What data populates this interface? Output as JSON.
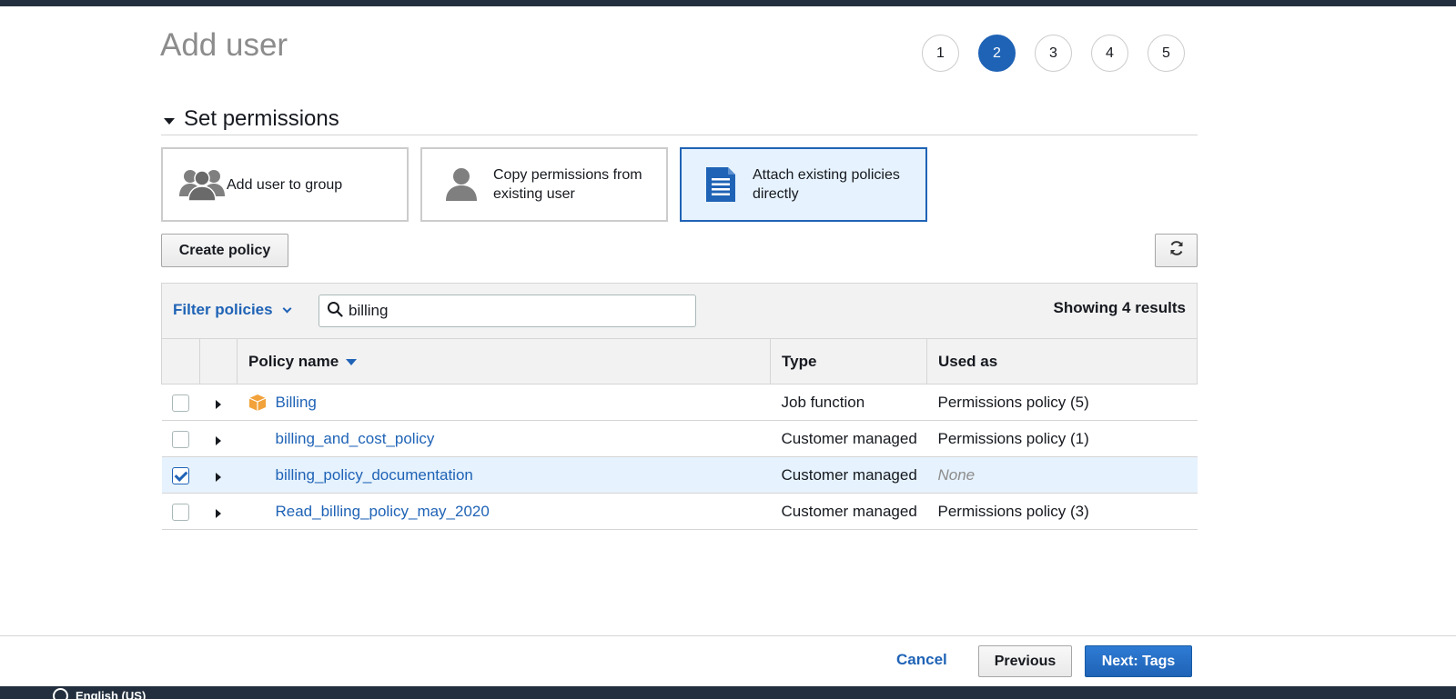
{
  "page": {
    "title": "Add user"
  },
  "steps": [
    "1",
    "2",
    "3",
    "4",
    "5"
  ],
  "active_step": "2",
  "section": {
    "title": "Set permissions"
  },
  "options": [
    {
      "label": "Add user to group",
      "icon": "users-group-icon",
      "selected": false
    },
    {
      "label": "Copy permissions from existing user",
      "icon": "user-icon",
      "selected": false
    },
    {
      "label": "Attach existing policies directly",
      "icon": "document-icon",
      "selected": true
    }
  ],
  "toolbar": {
    "create_policy": "Create policy",
    "refresh_icon": "refresh-icon"
  },
  "filter": {
    "label": "Filter policies",
    "search_value": "billing",
    "results": "Showing 4 results"
  },
  "table": {
    "headers": {
      "name": "Policy name",
      "type": "Type",
      "used_as": "Used as"
    },
    "rows": [
      {
        "checked": false,
        "name": "Billing",
        "aws_managed_icon": true,
        "type": "Job function",
        "used_as": "Permissions policy (5)"
      },
      {
        "checked": false,
        "name": "billing_and_cost_policy",
        "aws_managed_icon": false,
        "type": "Customer managed",
        "used_as": "Permissions policy (1)"
      },
      {
        "checked": true,
        "name": "billing_policy_documentation",
        "aws_managed_icon": false,
        "type": "Customer managed",
        "used_as": "None"
      },
      {
        "checked": false,
        "name": "Read_billing_policy_may_2020",
        "aws_managed_icon": false,
        "type": "Customer managed",
        "used_as": "Permissions policy (3)"
      }
    ]
  },
  "actions": {
    "cancel": "Cancel",
    "previous": "Previous",
    "next": "Next: Tags"
  },
  "footer": {
    "language": "English (US)"
  },
  "colors": {
    "accent": "#1f63b6",
    "header_bg": "#232f3e",
    "selected_bg": "#e6f2fd"
  }
}
